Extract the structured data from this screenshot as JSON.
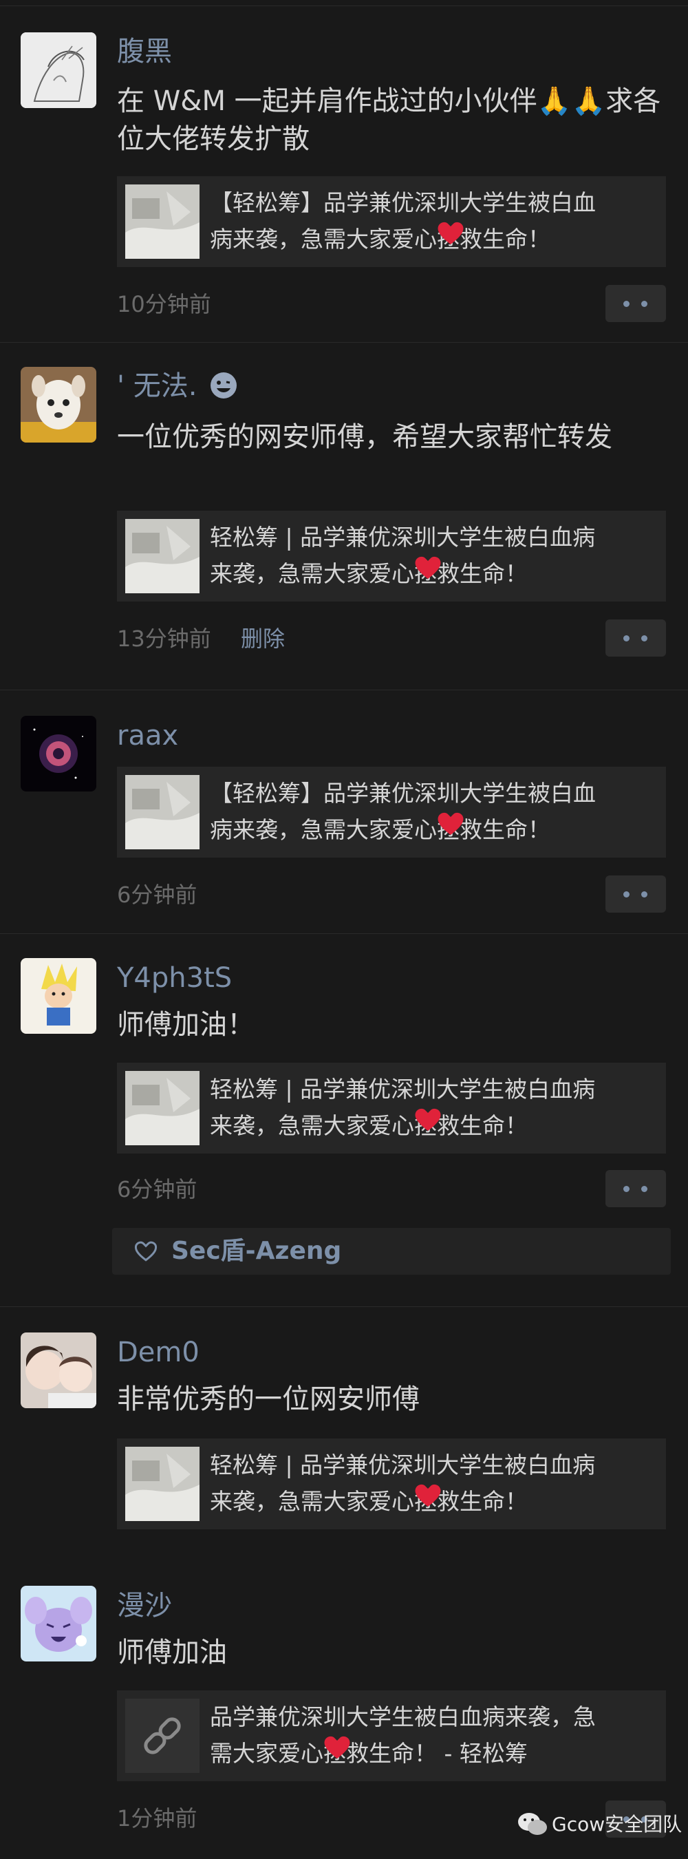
{
  "posts": [
    {
      "name": "腹黑",
      "content": "在 W&M 一起并肩作战过的小伙伴🙏🙏求各位大佬转发扩散",
      "link_a": "【轻松筹】品学兼优深圳大学生被白血",
      "link_b": "病来袭，急需大家爱心",
      "link_c": "拯救生命！",
      "time": "10分钟前"
    },
    {
      "name": "' 无法. ",
      "content": "一位优秀的网安师傅，希望大家帮忙转发",
      "link_a": "轻松筹 | 品学兼优深圳大学生被白血病",
      "link_b": "来袭，急需大家爱心",
      "link_c": "拯救生命！",
      "time": "13分钟前",
      "delete": "删除"
    },
    {
      "name": "raax",
      "link_a": "【轻松筹】品学兼优深圳大学生被白血",
      "link_b": "病来袭，急需大家爱心",
      "link_c": "拯救生命！",
      "time": "6分钟前"
    },
    {
      "name": "Y4ph3tS",
      "content": "师傅加油！",
      "link_a": "轻松筹 | 品学兼优深圳大学生被白血病",
      "link_b": "来袭，急需大家爱心",
      "link_c": "拯救生命！",
      "time": "6分钟前",
      "like": "Sec盾-Azeng"
    },
    {
      "name": "Dem0",
      "content": "非常优秀的一位网安师傅",
      "link_a": "轻松筹 | 品学兼优深圳大学生被白血病",
      "link_b": "来袭，急需大家爱心",
      "link_c": "拯救生命！"
    },
    {
      "name": "漫沙",
      "content": "师傅加油",
      "link_a": "品学兼优深圳大学生被白血病来袭，急",
      "link_b": "需大家爱心",
      "link_c": "拯救生命！ - 轻松筹",
      "time": "1分钟前"
    }
  ],
  "watermark": "Gcow安全团队",
  "colors": {
    "background": "#191919",
    "name": "#7d90a9",
    "text": "#d5d5d5",
    "time": "#6b6b6b",
    "heart": "#e0223a"
  }
}
